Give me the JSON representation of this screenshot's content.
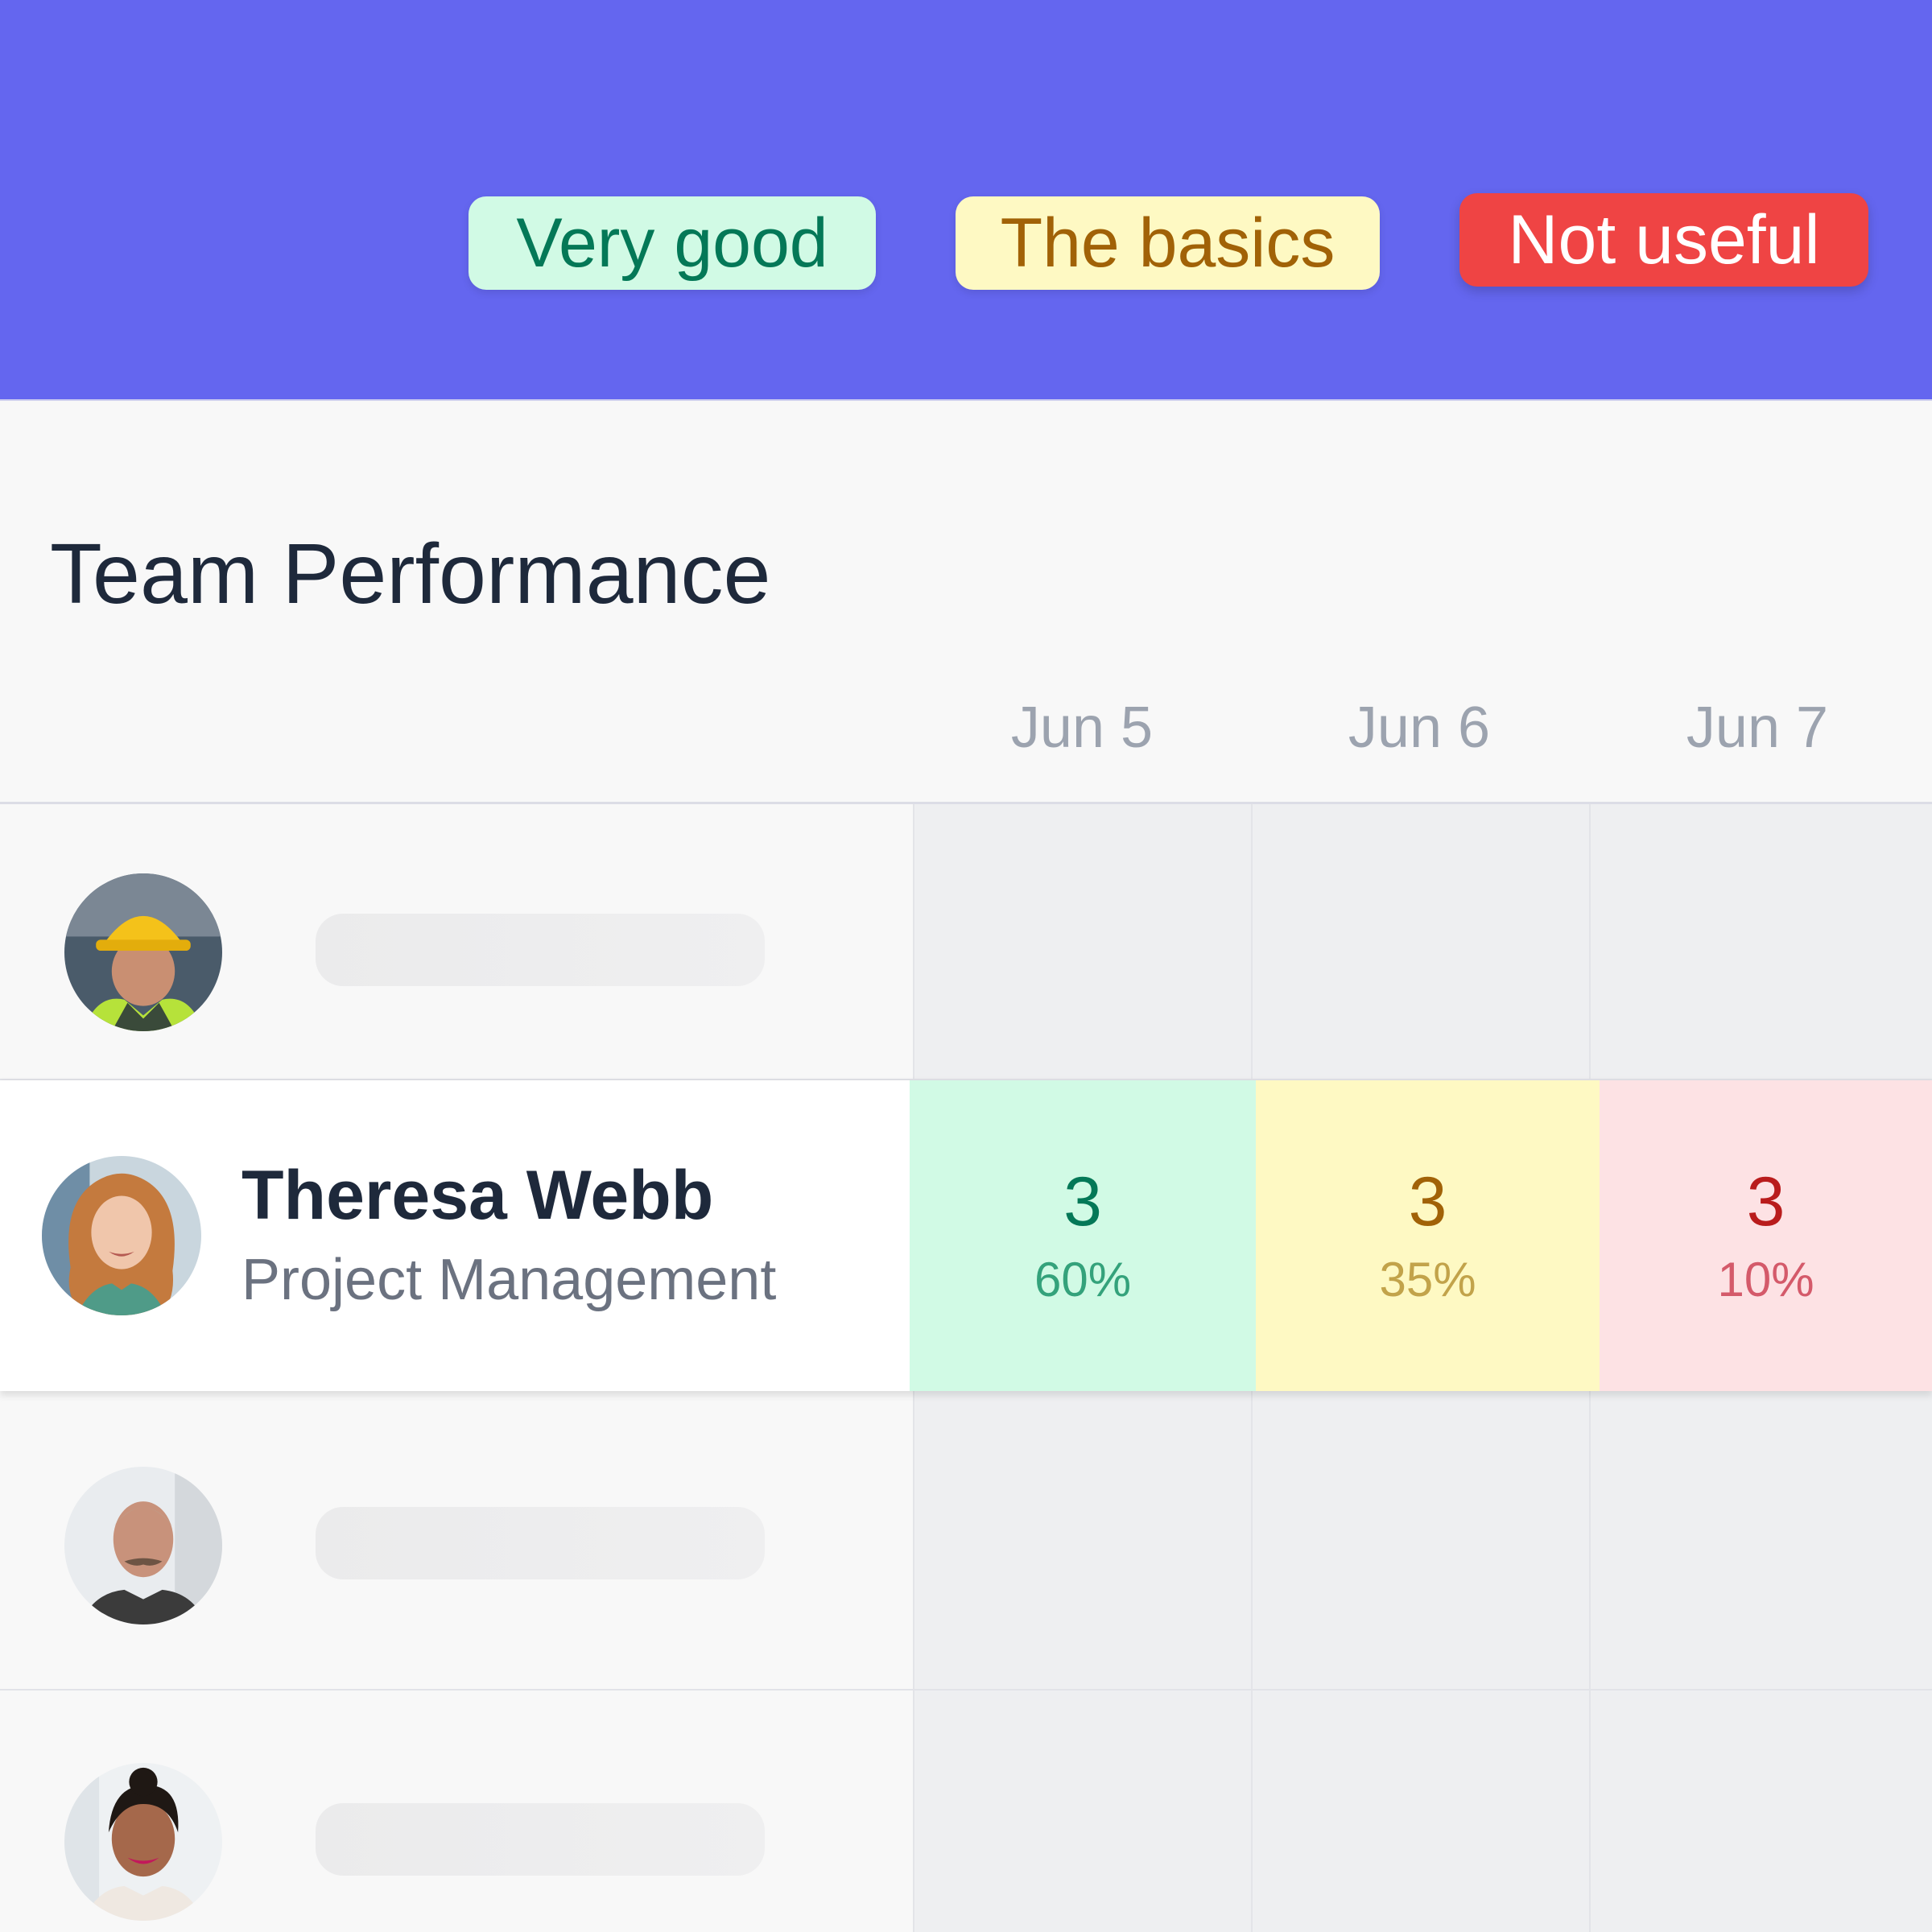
{
  "legend": {
    "very_good": "Very good",
    "the_basics": "The basics",
    "not_useful": "Not useful"
  },
  "title": "Team Performance",
  "columns": [
    "Jun 5",
    "Jun 6",
    "Jun 7"
  ],
  "highlighted_member": {
    "name": "Theresa Webb",
    "role": "Project Management",
    "scores": [
      {
        "count": "3",
        "percent": "60%"
      },
      {
        "count": "3",
        "percent": "35%"
      },
      {
        "count": "3",
        "percent": "10%"
      }
    ]
  },
  "colors": {
    "header": "#6466ef",
    "very_good_bg": "#d1fae5",
    "very_good_text": "#047857",
    "basics_bg": "#fef9c3",
    "basics_text": "#a16207",
    "not_useful_bg": "#ef4444",
    "not_useful_cell_bg": "#fde2e4",
    "not_useful_text": "#b91c1c"
  }
}
